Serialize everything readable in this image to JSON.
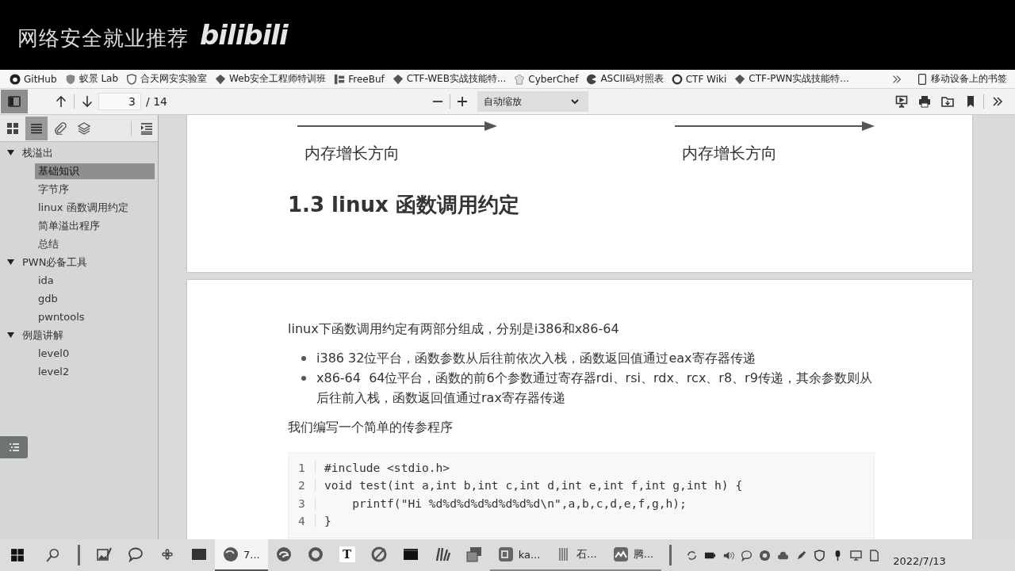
{
  "banner": {
    "title": "网络安全就业推荐",
    "logo": "bilibili"
  },
  "bookmarks": {
    "items": [
      {
        "label": "GitHub"
      },
      {
        "label": "蚁景 Lab"
      },
      {
        "label": "合天网安实验室"
      },
      {
        "label": "Web安全工程师特训班"
      },
      {
        "label": "FreeBuf"
      },
      {
        "label": "CTF-WEB实战技能特..."
      },
      {
        "label": "CyberChef"
      },
      {
        "label": "ASCII码对照表"
      },
      {
        "label": "CTF Wiki"
      },
      {
        "label": "CTF-PWN实战技能特..."
      }
    ],
    "folder": "移动设备上的书签"
  },
  "viewer_toolbar": {
    "page": "3",
    "page_count": "/ 14",
    "zoom": "自动缩放"
  },
  "sidebar": {
    "tabs": [
      {
        "selected": false
      },
      {
        "selected": true
      },
      {
        "selected": false
      },
      {
        "selected": false
      }
    ],
    "outline": [
      {
        "label": "栈溢出",
        "expanded": true,
        "selected": false,
        "children": [
          {
            "label": "基础知识",
            "selected": true
          },
          {
            "label": "字节序",
            "selected": false
          },
          {
            "label": "linux 函数调用约定",
            "selected": false
          },
          {
            "label": "简单溢出程序",
            "selected": false
          },
          {
            "label": "总结",
            "selected": false
          }
        ]
      },
      {
        "label": "PWN必备工具",
        "expanded": true,
        "selected": false,
        "children": [
          {
            "label": "ida",
            "selected": false
          },
          {
            "label": "gdb",
            "selected": false
          },
          {
            "label": "pwntools",
            "selected": false
          }
        ]
      },
      {
        "label": "例题讲解",
        "expanded": true,
        "selected": false,
        "children": [
          {
            "label": "level0",
            "selected": false
          },
          {
            "label": "level2",
            "selected": false
          }
        ]
      }
    ]
  },
  "document": {
    "page_1": {
      "arrows": [
        {
          "label": "内存增长方向"
        },
        {
          "label": "内存增长方向"
        }
      ],
      "heading": "1.3 linux 函数调用约定"
    },
    "page_2": {
      "intro": "linux下函数调用约定有两部分组成，分别是i386和x86-64",
      "bullets": [
        "i386 32位平台，函数参数从后往前依次入栈，函数返回值通过eax寄存器传递",
        "x86-64  64位平台，函数的前6个参数通过寄存器rdi、rsi、rdx、rcx、r8、r9传递，其余参数则从后往前入栈，函数返回值通过rax寄存器传递"
      ],
      "note": "我们编写一个简单的传参程序",
      "code": [
        {
          "number": "1",
          "text": "#include <stdio.h>"
        },
        {
          "number": "2",
          "text": "void test(int a,int b,int c,int d,int e,int f,int g,int h) {"
        },
        {
          "number": "3",
          "text": "    printf(\"Hi %d%d%d%d%d%d%d%d\\n\",a,b,c,d,e,f,g,h);"
        },
        {
          "number": "4",
          "text": "}"
        }
      ]
    }
  },
  "taskbar": {
    "apps": [
      {
        "selected": false
      },
      {
        "selected": false
      },
      {
        "selected": false
      },
      {
        "selected": false
      },
      {
        "label": "7...",
        "selected": true
      },
      {
        "selected": false
      },
      {
        "selected": false
      },
      {
        "glyph": "T",
        "selected": false
      },
      {
        "selected": false
      },
      {
        "selected": false
      },
      {
        "selected": false
      },
      {
        "selected": false
      },
      {
        "label": "ka...",
        "selected": false
      },
      {
        "label": "石...",
        "selected": false
      },
      {
        "label": "腾...",
        "selected": false
      }
    ],
    "date": "2022/7/13"
  }
}
